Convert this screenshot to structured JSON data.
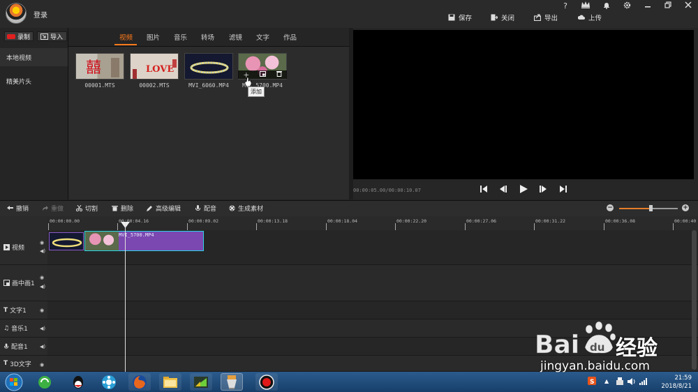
{
  "header": {
    "login_label": "登录",
    "window_controls": [
      "?",
      "VIP",
      "bell-icon",
      "gear-icon",
      "minimize-icon",
      "restore-icon",
      "close-icon"
    ],
    "actions": [
      {
        "label": "保存",
        "icon": "save-icon"
      },
      {
        "label": "关闭",
        "icon": "close-doc-icon"
      },
      {
        "label": "导出",
        "icon": "export-icon"
      },
      {
        "label": "上传",
        "icon": "upload-icon"
      }
    ]
  },
  "left_panel": {
    "record_label": "录制",
    "import_label": "导入",
    "items": [
      {
        "label": "本地视频",
        "active": true
      },
      {
        "label": "精美片头",
        "active": false
      }
    ]
  },
  "tabs": [
    {
      "label": "视频",
      "active": true
    },
    {
      "label": "图片",
      "active": false
    },
    {
      "label": "音乐",
      "active": false
    },
    {
      "label": "转场",
      "active": false
    },
    {
      "label": "滤镜",
      "active": false
    },
    {
      "label": "文字",
      "active": false
    },
    {
      "label": "作品",
      "active": false
    }
  ],
  "media": [
    {
      "name": "00001.MTS"
    },
    {
      "name": "00002.MTS"
    },
    {
      "name": "MVI_6060.MP4"
    },
    {
      "name": "MVI_5700.MP4"
    }
  ],
  "tooltip": "添加",
  "preview": {
    "timecode": "00:00:05.00/00:00:10.07"
  },
  "toolbar": [
    {
      "label": "撤销",
      "icon": "undo-icon",
      "enabled": true
    },
    {
      "label": "重做",
      "icon": "redo-icon",
      "enabled": false
    },
    {
      "label": "切割",
      "icon": "scissors-icon",
      "enabled": true
    },
    {
      "label": "删除",
      "icon": "trash-icon",
      "enabled": true
    },
    {
      "label": "高级编辑",
      "icon": "pencil-icon",
      "enabled": true
    },
    {
      "label": "配音",
      "icon": "mic-icon",
      "enabled": true
    },
    {
      "label": "生成素材",
      "icon": "film-reel-icon",
      "enabled": true
    }
  ],
  "zoom": {
    "level": 0.55
  },
  "ruler": [
    "00:00:00.00",
    "00:00:04.16",
    "00:00:09.02",
    "00:00:13.18",
    "00:00:18.04",
    "00:00:22.20",
    "00:00:27.06",
    "00:00:31.22",
    "00:00:36.08",
    "00:00:40"
  ],
  "tracks": [
    {
      "label": "视频",
      "icon": "play-icon"
    },
    {
      "label": "画中画1",
      "icon": "pip-icon"
    },
    {
      "label": "文字1",
      "icon": "text-icon"
    },
    {
      "label": "音乐1",
      "icon": "music-icon"
    },
    {
      "label": "配音1",
      "icon": "mic-icon"
    },
    {
      "label": "3D文字",
      "icon": "text-icon"
    }
  ],
  "timeline_clip_label": "MVI_5700.MP4",
  "taskbar": {
    "time": "21:59",
    "date": "2018/8/21"
  },
  "watermark": {
    "url": "jingyan.baidu.com",
    "brand": "经验"
  }
}
